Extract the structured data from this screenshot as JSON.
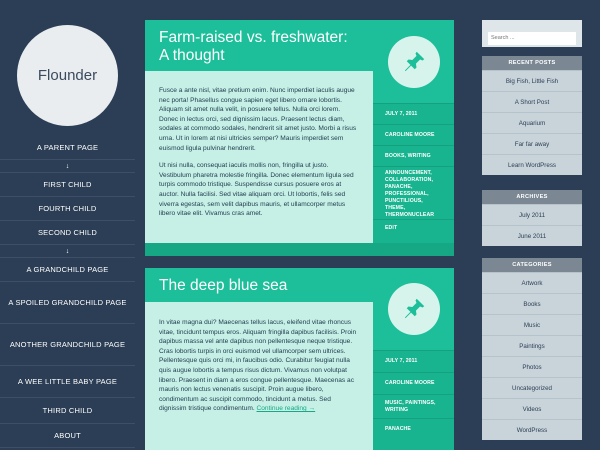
{
  "site": {
    "title": "Flounder"
  },
  "nav": {
    "items": [
      "A PARENT PAGE",
      "FIRST CHILD",
      "FOURTH CHILD",
      "SECOND CHILD",
      "A GRANDCHILD PAGE",
      "A SPOILED GRANDCHILD PAGE",
      "ANOTHER GRANDCHILD PAGE",
      "A WEE LITTLE BABY PAGE",
      "THIRD CHILD",
      "ABOUT"
    ],
    "arrow": "↓"
  },
  "posts": [
    {
      "title_line1": "Farm-raised vs. freshwater:",
      "title_line2": "A thought",
      "paragraphs": [
        "Fusce a ante nisl, vitae pretium enim. Nunc imperdiet iaculis augue nec porta! Phasellus congue sapien eget libero ornare lobortis. Aliquam sit amet nulla velit, in posuere tellus. Nulla orci lorem. Donec in lectus orci, sed dignissim lacus. Praesent lectus diam, sodales at commodo sodales, hendrerit sit amet justo. Morbi a risus urna. Ut in lorem at nisi ultricies semper? Mauris imperdiet sem euismod ligula pulvinar hendrerit.",
        "Ut nisi nulla, consequat iaculis mollis non, fringilla ut justo. Vestibulum pharetra molestie fringilla. Donec elementum ligula sed turpis commodo tristique. Suspendisse cursus posuere eros at auctor. Nulla facilisi. Sed vitae aliquam orci. Ut lobortis, felis sed viverra egestas, sem velit dapibus mauris, et ullamcorper metus libero vitae elit. Vivamus cras amet."
      ],
      "meta": {
        "date": "JULY 7, 2011",
        "author": "CAROLINE MOORE",
        "categories": "BOOKS, WRITING",
        "tags": "ANNOUNCEMENT, COLLABORATION, PANACHE, PROFESSIONAL, PUNCTILIOUS, THEME, THERMONUCLEAR",
        "edit": "EDIT"
      }
    },
    {
      "title": "The deep blue sea",
      "paragraph": "In vitae magna dui? Maecenas tellus lacus, eleifend vitae rhoncus vitae, tincidunt tempus eros. Aliquam fringilla dapibus facilisis. Proin dapibus massa vel ante dapibus non pellentesque neque tristique. Cras lobortis turpis in orci euismod vel ullamcorper sem ultrices. Pellentesque quis orci mi, in faucibus odio. Curabitur feugiat nulla quis augue lobortis a tempus risus dictum. Vivamus non volutpat libero. Praesent in diam a eros congue pellentesque. Maecenas ac mauris non lectus venenatis suscipit. Proin augue libero, condimentum ac suscipit commodo, tincidunt a metus. Sed dignissim tristique condimentum.",
      "read_more": "Continue reading →",
      "meta": {
        "date": "JULY 7, 2011",
        "author": "CAROLINE MOORE",
        "categories": "MUSIC, PAINTINGS, WRITING",
        "tags": "PANACHE"
      }
    }
  ],
  "search": {
    "placeholder": "Search ..."
  },
  "widgets": {
    "recent": {
      "title": "RECENT POSTS",
      "items": [
        "Big Fish, Little Fish",
        "A Short Post",
        "Aquarium",
        "Far far away",
        "Learn WordPress"
      ]
    },
    "archives": {
      "title": "ARCHIVES",
      "items": [
        "July 2011",
        "June 2011"
      ]
    },
    "categories": {
      "title": "CATEGORIES",
      "items": [
        "Artwork",
        "Books",
        "Music",
        "Paintings",
        "Photos",
        "Uncategorized",
        "Videos",
        "WordPress"
      ]
    }
  },
  "colors": {
    "background": "#2c3e55",
    "accent": "#1cbf9a",
    "post_bg": "#c6efe6",
    "widget_bg": "#c9d4da"
  },
  "icons": {
    "post_format": "pushpin-icon"
  }
}
